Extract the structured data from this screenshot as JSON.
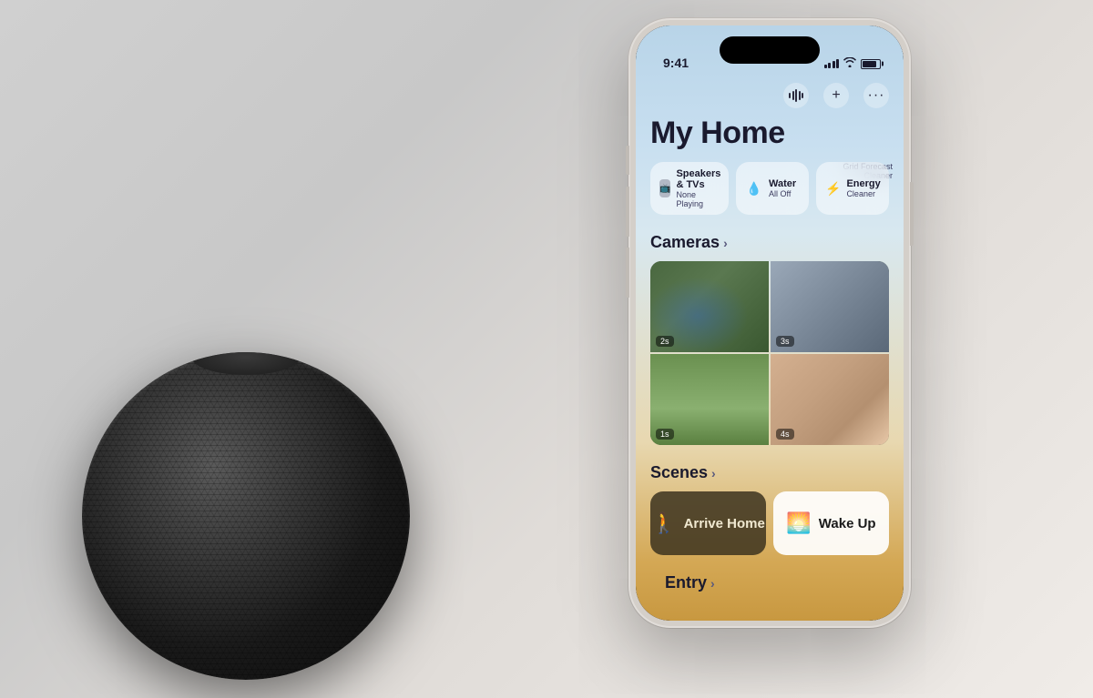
{
  "background": {
    "color": "#e0dcd8"
  },
  "status_bar": {
    "time": "9:41",
    "signal_bars": [
      4,
      6,
      8,
      10,
      12
    ],
    "battery_level": "85%"
  },
  "header": {
    "title": "My Home",
    "action_icons": [
      "waveform",
      "plus",
      "ellipsis"
    ],
    "grid_forecast_label": "Grid Forecast",
    "grid_forecast_sub": "Cleaner"
  },
  "categories": [
    {
      "id": "speakers",
      "icon": "📺",
      "label": "Speakers & TVs",
      "sublabel": "None Playing"
    },
    {
      "id": "water",
      "icon": "💧",
      "label": "Water",
      "sublabel": "All Off"
    },
    {
      "id": "energy",
      "icon": "⚡",
      "label": "Energy",
      "sublabel": "Cleaner"
    }
  ],
  "cameras": {
    "section_label": "Cameras",
    "items": [
      {
        "id": "cam1",
        "timer": "2s",
        "type": "pool"
      },
      {
        "id": "cam2",
        "timer": "3s",
        "type": "gym"
      },
      {
        "id": "cam3",
        "timer": "1s",
        "type": "garden"
      },
      {
        "id": "cam4",
        "timer": "4s",
        "type": "living"
      }
    ]
  },
  "scenes": {
    "section_label": "Scenes",
    "items": [
      {
        "id": "arrive-home",
        "icon": "🚶",
        "label": "Arrive Home",
        "style": "dark"
      },
      {
        "id": "wake-up",
        "icon": "🌅",
        "label": "Wake Up",
        "style": "light"
      }
    ]
  },
  "entry": {
    "section_label": "Entry"
  }
}
